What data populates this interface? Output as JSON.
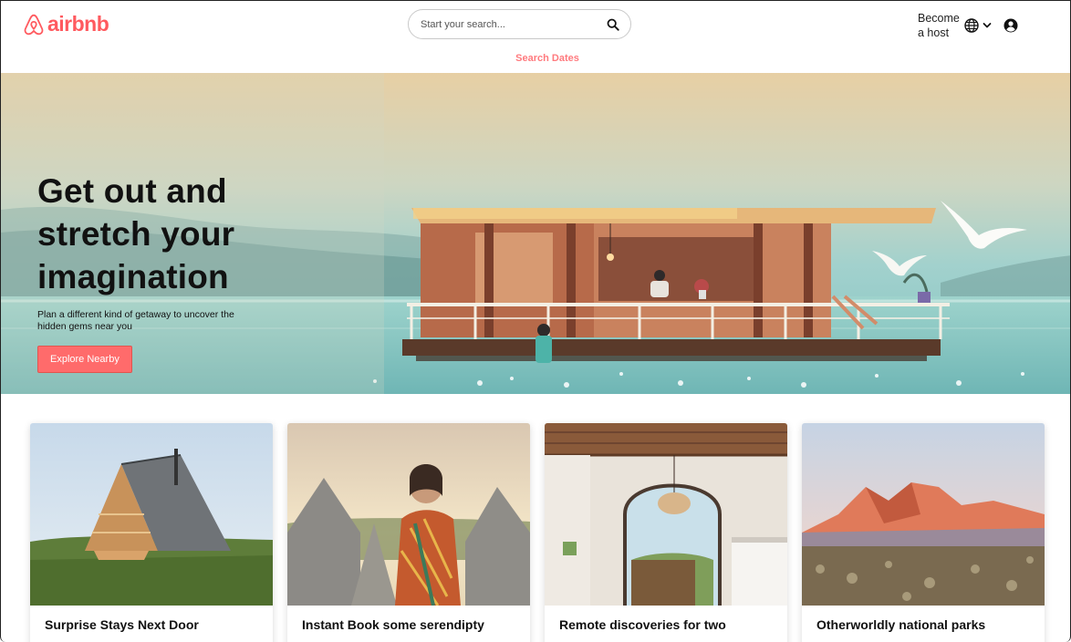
{
  "header": {
    "brand": "airbnb",
    "brand_color": "#ff5a5f",
    "search_placeholder": "Start your search...",
    "search_dates_label": "Search Dates",
    "become_host_label": "Become a host",
    "icons": [
      "airbnb-logo-icon",
      "search-icon",
      "globe-icon",
      "chevron-down-icon",
      "user-circle-icon"
    ]
  },
  "hero": {
    "title": "Get out and stretch your imagination",
    "subtitle": "Plan a different kind of getaway to uncover the hidden gems near you",
    "button_label": "Explore Nearby",
    "button_color": "#ff6b6b"
  },
  "cards": [
    {
      "title": "Surprise Stays Next Door",
      "description": ""
    },
    {
      "title": "Instant Book some serendipty",
      "description": ""
    },
    {
      "title": "Remote discoveries for two",
      "description": ""
    },
    {
      "title": "Otherworldly national parks",
      "description": ""
    }
  ]
}
